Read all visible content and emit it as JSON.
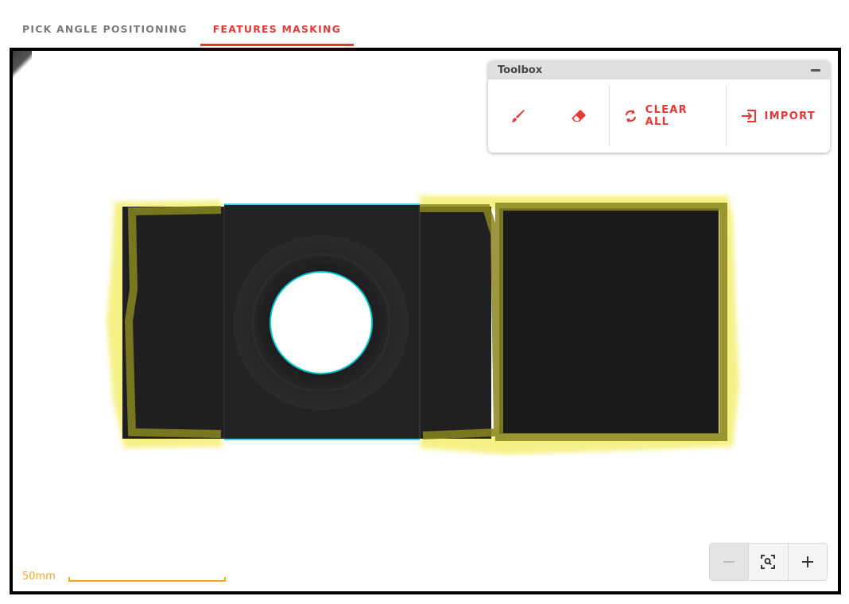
{
  "tabs": [
    {
      "label": "PICK ANGLE POSITIONING",
      "active": false
    },
    {
      "label": "FEATURES MASKING",
      "active": true
    }
  ],
  "toolbox": {
    "title": "Toolbox",
    "collapse_icon": "minus-icon",
    "tools": [
      {
        "icon": "brush-icon",
        "label": ""
      },
      {
        "icon": "eraser-icon",
        "label": ""
      }
    ],
    "clear_all_label": "CLEAR ALL",
    "clear_all_icon": "refresh-icon",
    "import_label": "IMPORT",
    "import_icon": "import-icon"
  },
  "scale": {
    "label": "50mm"
  },
  "zoom_controls": {
    "zoom_out_icon": "minus-icon",
    "fit_icon": "zoom-fit-icon",
    "zoom_in_icon": "plus-icon",
    "zoom_out_disabled": true
  },
  "colors": {
    "accent": "#e53935",
    "tab_inactive": "#7a7a7a",
    "mask": "#f5f07a",
    "feature_outline": "#00c8d2",
    "scale": "#f5a623"
  }
}
